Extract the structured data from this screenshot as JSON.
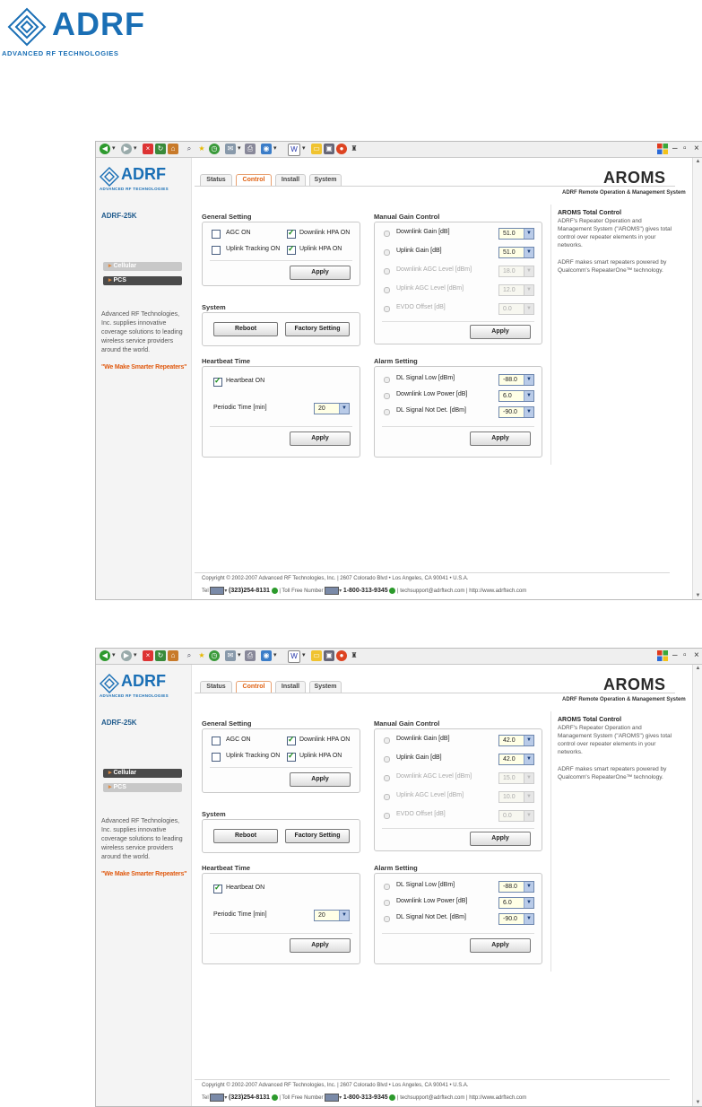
{
  "doc": {
    "logo_text": "ADRF",
    "logo_tagline": "ADVANCED RF TECHNOLOGIES"
  },
  "colors": {
    "brand_blue": "#1a6fb5",
    "accent_orange": "#e06010",
    "select_bg": "#ffffe6"
  },
  "screens": [
    {
      "brand": {
        "logo_text": "ADRF",
        "logo_sub": "ADVANCED RF TECHNOLOGIES",
        "product": "AROMS",
        "product_sub": "ADRF Remote Operation & Management System"
      },
      "model": "ADRF-25K",
      "bands": [
        {
          "label": "Cellular",
          "active": false
        },
        {
          "label": "PCS",
          "active": true
        }
      ],
      "sidebar_text": "Advanced RF Technologies, Inc. supplies innovative coverage solutions to leading wireless service providers around the world.",
      "slogan": "\"We Make Smarter Repeaters\"",
      "tabs": [
        "Status",
        "Control",
        "Install",
        "System"
      ],
      "active_tab": "Control",
      "general": {
        "title": "General Setting",
        "agc": "AGC ON",
        "agc_checked": false,
        "dl_hpa": "Downlink HPA ON",
        "dl_hpa_checked": true,
        "ul_tracking": "Uplink Tracking ON",
        "ul_tracking_checked": false,
        "ul_hpa": "Uplink HPA ON",
        "ul_hpa_checked": true,
        "apply": "Apply"
      },
      "system": {
        "title": "System",
        "reboot": "Reboot",
        "factory": "Factory Setting"
      },
      "heartbeat": {
        "title": "Heartbeat Time",
        "hb": "Heartbeat ON",
        "hb_checked": true,
        "periodic_label": "Periodic Time [min]",
        "periodic_value": "20",
        "apply": "Apply"
      },
      "mgc": {
        "title": "Manual Gain Control",
        "rows": [
          {
            "label": "Downlink Gain [dB]",
            "value": "51.0",
            "enabled": true
          },
          {
            "label": "Uplink Gain [dB]",
            "value": "51.0",
            "enabled": true
          },
          {
            "label": "Downlink AGC Level [dBm]",
            "value": "18.0",
            "enabled": false
          },
          {
            "label": "Uplink AGC Level [dBm]",
            "value": "12.0",
            "enabled": false
          },
          {
            "label": "EVDO Offset [dB]",
            "value": "0.0",
            "enabled": false
          }
        ],
        "apply": "Apply"
      },
      "alarm": {
        "title": "Alarm Setting",
        "rows": [
          {
            "label": "DL Signal Low [dBm]",
            "value": "-88.0"
          },
          {
            "label": "Downlink Low Power [dB]",
            "value": "6.0"
          },
          {
            "label": "DL Signal Not Det. [dBm]",
            "value": "-90.0"
          }
        ],
        "apply": "Apply"
      },
      "info": {
        "title": "AROMS Total Control",
        "p1": "ADRF's Repeater Operation and Management System (\"AROMS\") gives total control over repeater elements in your networks.",
        "p2": "ADRF makes smart repeaters powered by Qualcomm's RepeaterOne™ technology."
      },
      "footer": {
        "copyright": "Copyright © 2002-2007 Advanced RF Technologies, Inc. | 2607 Colorado Blvd • Los Angeles, CA 90041 • U.S.A.",
        "tel_label": "Tel",
        "tel": "(323)254-8131",
        "tollfree_label": "| Toll Free Number",
        "tollfree": "1-800-313-9345",
        "email": "| techsupport@adrftech.com",
        "url": "| http://www.adrftech.com"
      }
    },
    {
      "brand": {
        "logo_text": "ADRF",
        "logo_sub": "ADVANCED RF TECHNOLOGIES",
        "product": "AROMS",
        "product_sub": "ADRF Remote Operation & Management System"
      },
      "model": "ADRF-25K",
      "bands": [
        {
          "label": "Cellular",
          "active": true
        },
        {
          "label": "PCS",
          "active": false
        }
      ],
      "sidebar_text": "Advanced RF Technologies, Inc. supplies innovative coverage solutions to leading wireless service providers around the world.",
      "slogan": "\"We Make Smarter Repeaters\"",
      "tabs": [
        "Status",
        "Control",
        "Install",
        "System"
      ],
      "active_tab": "Control",
      "general": {
        "title": "General Setting",
        "agc": "AGC ON",
        "agc_checked": false,
        "dl_hpa": "Downlink HPA ON",
        "dl_hpa_checked": true,
        "ul_tracking": "Uplink Tracking ON",
        "ul_tracking_checked": false,
        "ul_hpa": "Uplink HPA ON",
        "ul_hpa_checked": true,
        "apply": "Apply"
      },
      "system": {
        "title": "System",
        "reboot": "Reboot",
        "factory": "Factory Setting"
      },
      "heartbeat": {
        "title": "Heartbeat Time",
        "hb": "Heartbeat ON",
        "hb_checked": true,
        "periodic_label": "Periodic Time [min]",
        "periodic_value": "20",
        "apply": "Apply"
      },
      "mgc": {
        "title": "Manual Gain Control",
        "rows": [
          {
            "label": "Downlink Gain [dB]",
            "value": "42.0",
            "enabled": true
          },
          {
            "label": "Uplink Gain [dB]",
            "value": "42.0",
            "enabled": true
          },
          {
            "label": "Downlink AGC Level [dBm]",
            "value": "15.0",
            "enabled": false
          },
          {
            "label": "Uplink AGC Level [dBm]",
            "value": "10.0",
            "enabled": false
          },
          {
            "label": "EVDO Offset [dB]",
            "value": "0.0",
            "enabled": false
          }
        ],
        "apply": "Apply"
      },
      "alarm": {
        "title": "Alarm Setting",
        "rows": [
          {
            "label": "DL Signal Low [dBm]",
            "value": "-88.0"
          },
          {
            "label": "Downlink Low Power [dB]",
            "value": "6.0"
          },
          {
            "label": "DL Signal Not Det. [dBm]",
            "value": "-90.0"
          }
        ],
        "apply": "Apply"
      },
      "info": {
        "title": "AROMS Total Control",
        "p1": "ADRF's Repeater Operation and Management System (\"AROMS\") gives total control over repeater elements in your networks.",
        "p2": "ADRF makes smart repeaters powered by Qualcomm's RepeaterOne™ technology."
      },
      "footer": {
        "copyright": "Copyright © 2002-2007 Advanced RF Technologies, Inc. | 2607 Colorado Blvd • Los Angeles, CA 90041 • U.S.A.",
        "tel_label": "Tel",
        "tel": "(323)254-8131",
        "tollfree_label": "| Toll Free Number",
        "tollfree": "1-800-313-9345",
        "email": "| techsupport@adrftech.com",
        "url": "| http://www.adrftech.com"
      }
    }
  ]
}
